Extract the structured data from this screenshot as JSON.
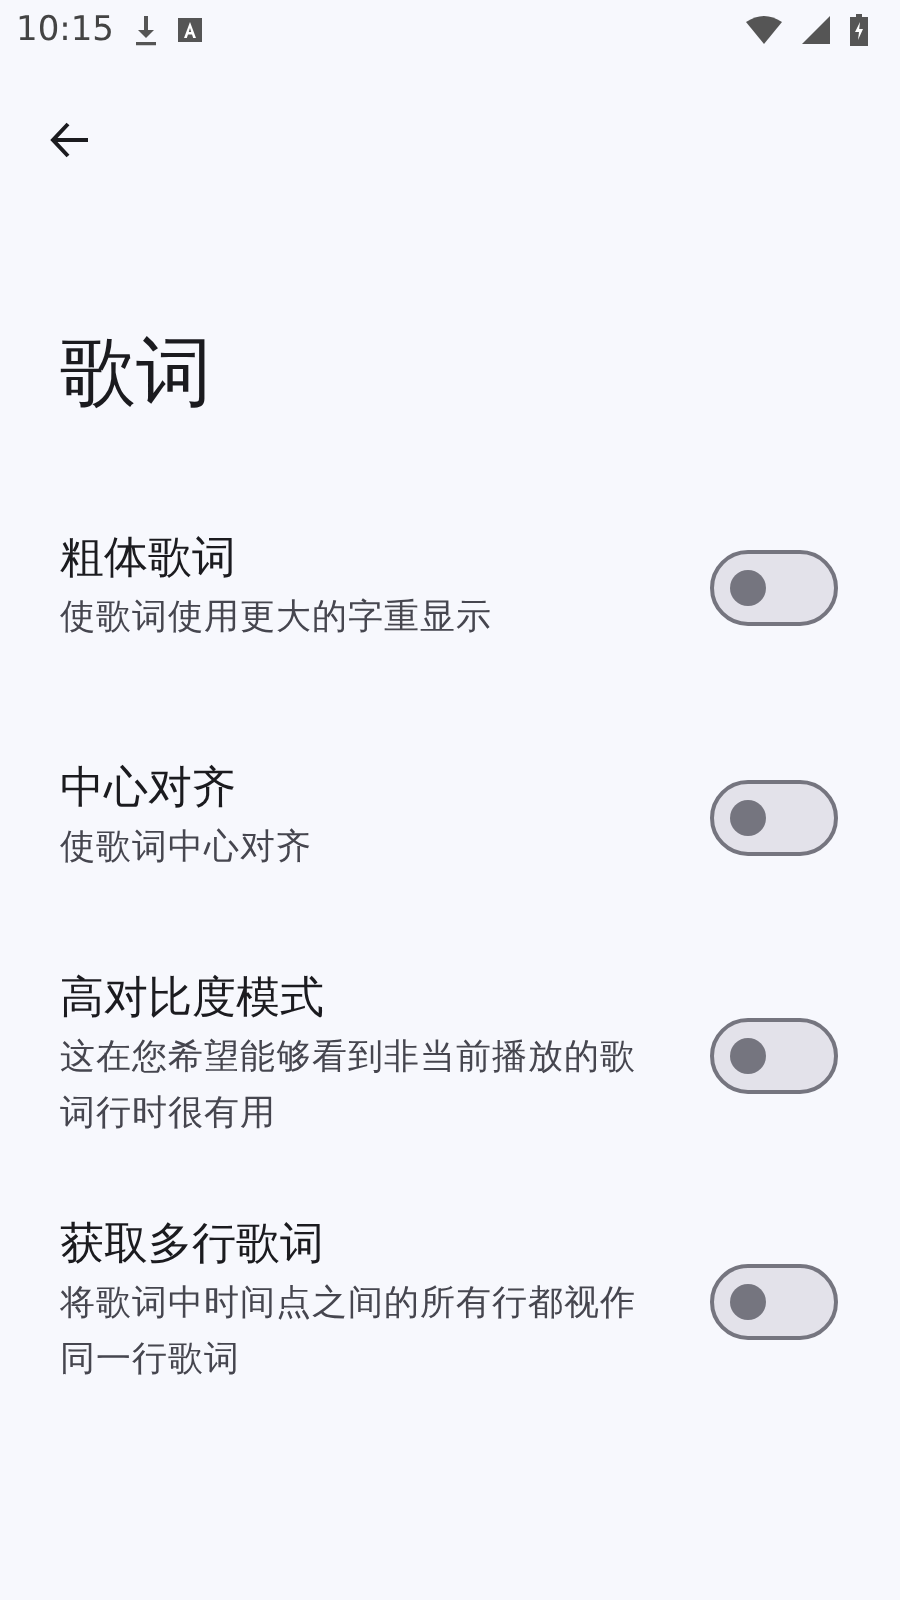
{
  "status_bar": {
    "time": "10:15"
  },
  "title": "歌词",
  "settings": [
    {
      "title": "粗体歌词",
      "summary": "使歌词使用更大的字重显示",
      "on": false
    },
    {
      "title": "中心对齐",
      "summary": "使歌词中心对齐",
      "on": false
    },
    {
      "title": "高对比度模式",
      "summary": "这在您希望能够看到非当前播放的歌词行时很有用",
      "on": false
    },
    {
      "title": "获取多行歌词",
      "summary": "将歌词中时间点之间的所有行都视作同一行歌词",
      "on": false
    }
  ]
}
